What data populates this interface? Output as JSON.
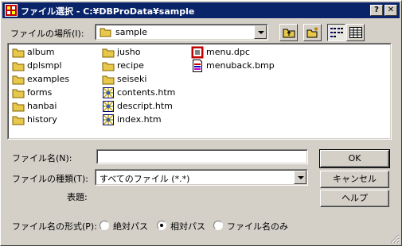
{
  "window": {
    "title": "ファイル選択 - C:¥DBProData¥sample",
    "help_button": "?",
    "close_button": "✕"
  },
  "location": {
    "label": "ファイルの場所(I):",
    "value": "sample"
  },
  "toolbar": {
    "up_icon": "folder-up-icon",
    "new_folder_icon": "new-folder-icon",
    "list_view_icon": "list-view-icon",
    "details_view_icon": "details-view-icon"
  },
  "files": {
    "col1": [
      {
        "name": "album",
        "icon": "folder-icon"
      },
      {
        "name": "dplsmpl",
        "icon": "folder-icon"
      },
      {
        "name": "examples",
        "icon": "folder-icon"
      },
      {
        "name": "forms",
        "icon": "folder-icon"
      },
      {
        "name": "hanbai",
        "icon": "folder-icon"
      },
      {
        "name": "history",
        "icon": "folder-icon"
      }
    ],
    "col2": [
      {
        "name": "jusho",
        "icon": "folder-icon"
      },
      {
        "name": "recipe",
        "icon": "folder-icon"
      },
      {
        "name": "seiseki",
        "icon": "folder-icon"
      },
      {
        "name": "contents.htm",
        "icon": "htm-file-icon"
      },
      {
        "name": "descript.htm",
        "icon": "htm-file-icon"
      },
      {
        "name": "index.htm",
        "icon": "htm-file-icon"
      }
    ],
    "col3": [
      {
        "name": "menu.dpc",
        "icon": "dpc-file-icon"
      },
      {
        "name": "menuback.bmp",
        "icon": "bmp-file-icon"
      }
    ]
  },
  "filename": {
    "label": "ファイル名(N):",
    "value": ""
  },
  "filetype": {
    "label": "ファイルの種類(T):",
    "value": "すべてのファイル (*.*)"
  },
  "title_field": {
    "label": "表題:"
  },
  "buttons": {
    "ok": "OK",
    "cancel": "キャンセル",
    "help": "ヘルプ"
  },
  "format": {
    "label": "ファイル名の形式(P):",
    "options": [
      "絶対パス",
      "相対パス",
      "ファイル名のみ"
    ],
    "selected": "相対パス"
  },
  "colors": {
    "titlebar": "#0a246a",
    "face": "#d4d0c8",
    "folder": "#e8c84a"
  }
}
